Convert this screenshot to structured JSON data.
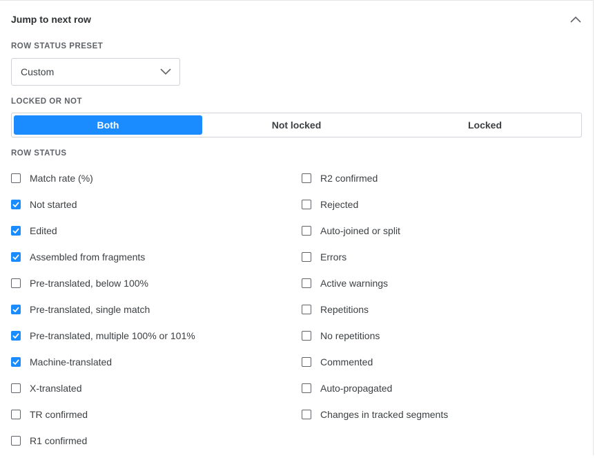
{
  "panel": {
    "title": "Jump to next row",
    "collapse_icon": "chevron-up-icon"
  },
  "row_status_preset": {
    "label": "ROW STATUS PRESET",
    "value": "Custom",
    "icon": "chevron-down-icon"
  },
  "locked": {
    "label": "LOCKED OR NOT",
    "options": [
      {
        "label": "Both",
        "active": true
      },
      {
        "label": "Not locked",
        "active": false
      },
      {
        "label": "Locked",
        "active": false
      }
    ]
  },
  "row_status": {
    "label": "ROW STATUS",
    "left": [
      {
        "label": "Match rate (%)",
        "checked": false
      },
      {
        "label": "Not started",
        "checked": true
      },
      {
        "label": "Edited",
        "checked": true
      },
      {
        "label": "Assembled from fragments",
        "checked": true
      },
      {
        "label": "Pre-translated, below 100%",
        "checked": false
      },
      {
        "label": "Pre-translated, single match",
        "checked": true
      },
      {
        "label": "Pre-translated, multiple 100% or 101%",
        "checked": true
      },
      {
        "label": "Machine-translated",
        "checked": true
      },
      {
        "label": "X-translated",
        "checked": false
      },
      {
        "label": "TR confirmed",
        "checked": false
      },
      {
        "label": "R1 confirmed",
        "checked": false
      }
    ],
    "right": [
      {
        "label": "R2 confirmed",
        "checked": false
      },
      {
        "label": "Rejected",
        "checked": false
      },
      {
        "label": "Auto-joined or split",
        "checked": false
      },
      {
        "label": "Errors",
        "checked": false
      },
      {
        "label": "Active warnings",
        "checked": false
      },
      {
        "label": "Repetitions",
        "checked": false
      },
      {
        "label": "No repetitions",
        "checked": false
      },
      {
        "label": "Commented",
        "checked": false
      },
      {
        "label": "Auto-propagated",
        "checked": false
      },
      {
        "label": "Changes in tracked segments",
        "checked": false
      }
    ]
  },
  "colors": {
    "accent": "#1a8cff",
    "text": "#3c4043",
    "border": "#cfd3d7"
  }
}
